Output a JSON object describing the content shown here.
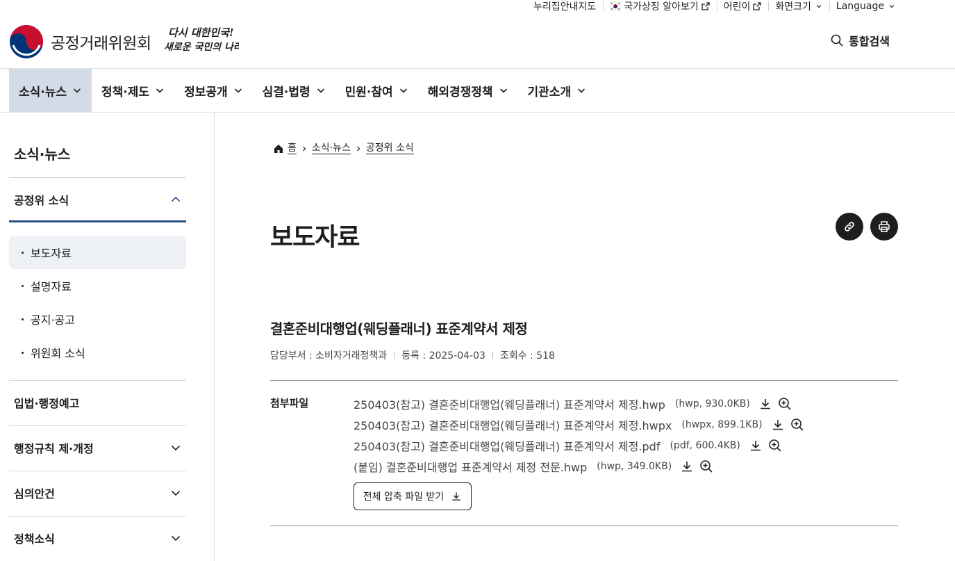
{
  "util": {
    "sitemap": "누리집안내지도",
    "national_symbols": "국가상징 알아보기",
    "kids": "어린이",
    "screen_size": "화면크기",
    "language": "Language"
  },
  "header": {
    "org_name": "공정거래위원회",
    "slogan_line1": "다시 대한민국!",
    "slogan_line2": "새로운 국민의 나라",
    "search_label": "통합검색"
  },
  "gnb": {
    "items": [
      {
        "label": "소식·뉴스"
      },
      {
        "label": "정책·제도"
      },
      {
        "label": "정보공개"
      },
      {
        "label": "심결·법령"
      },
      {
        "label": "민원·참여"
      },
      {
        "label": "해외경쟁정책"
      },
      {
        "label": "기관소개"
      }
    ]
  },
  "sidebar": {
    "title": "소식·뉴스",
    "open_section": "공정위 소식",
    "sub_items": [
      {
        "label": "보도자료"
      },
      {
        "label": "설명자료"
      },
      {
        "label": "공지·공고"
      },
      {
        "label": "위원회 소식"
      }
    ],
    "sections": [
      {
        "label": "입법·행정예고"
      },
      {
        "label": "행정규칙 제·개정"
      },
      {
        "label": "심의안건"
      },
      {
        "label": "정책소식"
      }
    ]
  },
  "breadcrumb": {
    "home": "홈",
    "level1": "소식·뉴스",
    "level2": "공정위 소식"
  },
  "page": {
    "title": "보도자료"
  },
  "article": {
    "title": "결혼준비대행업(웨딩플래너) 표준계약서 제정",
    "department": "담당부서 : 소비자거래정책과",
    "date": "등록 : 2025-04-03",
    "views": "조회수 : 518"
  },
  "attachments": {
    "label": "첨부파일",
    "files": [
      {
        "name": "250403(참고) 결혼준비대행업(웨딩플래너) 표준계약서 제정.hwp",
        "info": "(hwp, 930.0KB)"
      },
      {
        "name": "250403(참고) 결혼준비대행업(웨딩플래너) 표준계약서 제정.hwpx",
        "info": "(hwpx, 899.1KB)"
      },
      {
        "name": "250403(참고) 결혼준비대행업(웨딩플래너) 표준계약서 제정.pdf",
        "info": "(pdf, 600.4KB)"
      },
      {
        "name": "(붙임) 결혼준비대행업 표준계약서 제정 전문.hwp",
        "info": "(hwp, 349.0KB)"
      }
    ],
    "zip_label": "전체 압축 파일 받기"
  },
  "colors": {
    "accent": "#284e8a",
    "gnb_active": "#d2dbe6",
    "sub_active": "#eef1f5",
    "logo_red": "#c8102e",
    "logo_blue": "#003478"
  }
}
